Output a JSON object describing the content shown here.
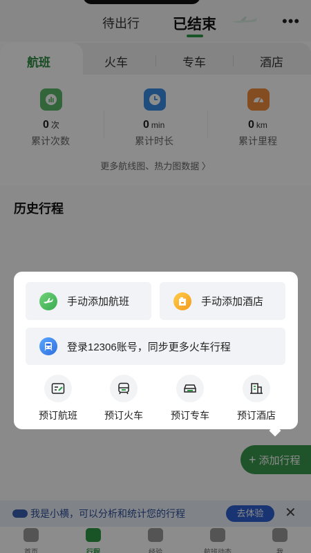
{
  "top_tabs": {
    "pending": "待出行",
    "ended": "已结束"
  },
  "more_icon": "ellipsis-icon",
  "category_tabs": [
    "航班",
    "火车",
    "专车",
    "酒店"
  ],
  "stats": [
    {
      "value": "0",
      "unit": "次",
      "label": "累计次数",
      "icon": "bar-chart-icon",
      "color": "#5cb86a"
    },
    {
      "value": "0",
      "unit": "min",
      "label": "累计时长",
      "icon": "clock-icon",
      "color": "#3a8ee6"
    },
    {
      "value": "0",
      "unit": "km",
      "label": "累计里程",
      "icon": "speedometer-icon",
      "color": "#f08a3c"
    }
  ],
  "more_data_link": "更多航线图、热力图数据 〉",
  "history_title": "历史行程",
  "popup": {
    "add_flight": "手动添加航班",
    "add_hotel": "手动添加酒店",
    "login_12306": "登录12306账号，同步更多火车行程",
    "quick_actions": [
      "预订航班",
      "预订火车",
      "预订专车",
      "预订酒店"
    ]
  },
  "fab_label": "添加行程",
  "ai_banner": {
    "text": "我是小横，可以分析和统计您的行程",
    "button": "去体验",
    "close": "✕"
  },
  "bottom_nav": [
    "首页",
    "行程",
    "经验",
    "航班动态",
    "我"
  ],
  "colors": {
    "accent_green": "#2c9a45",
    "blue": "#2f5fd0",
    "orange": "#f49a1e"
  }
}
